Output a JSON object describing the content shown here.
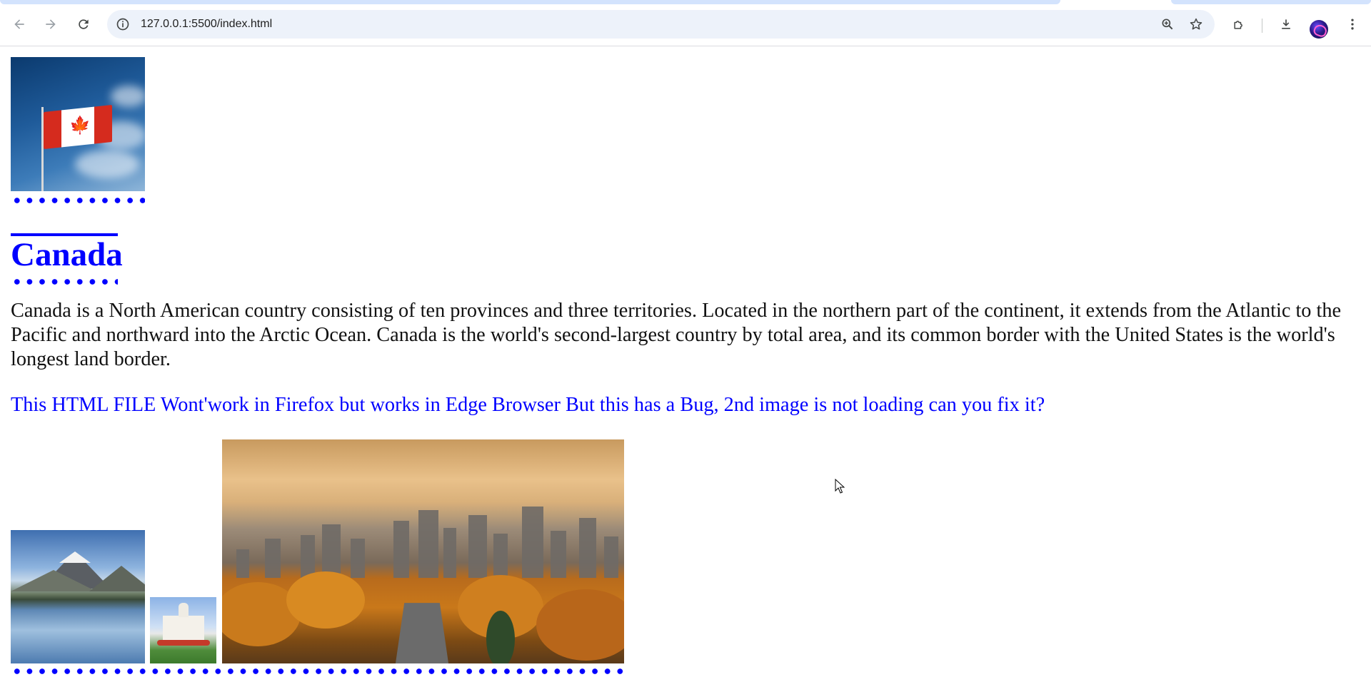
{
  "browser": {
    "url": "127.0.0.1:5500/index.html",
    "icons": [
      "back-icon",
      "forward-icon",
      "reload-icon",
      "site-info-icon",
      "zoom-icon",
      "bookmark-star-icon",
      "extensions-icon",
      "download-icon",
      "profile-avatar",
      "more-menu-icon"
    ]
  },
  "page": {
    "title": "Canada",
    "paragraph": "Canada is a North American country consisting of ten provinces and three territories. Located in the northern part of the continent, it extends from the Atlantic to the Pacific and northward into the Arctic Ocean. Canada is the world's second-largest country by total area, and its common border with the United States is the world's longest land border.",
    "note": "This HTML FILE Wont'work in Firefox but works in Edge Browser But this has a Bug, 2nd image is not loading can you fix it?",
    "images": [
      "canadian-flag",
      "mountain-lake",
      "white-palace",
      "autumn-city-skyline"
    ],
    "accent_color": "#0000ff"
  }
}
